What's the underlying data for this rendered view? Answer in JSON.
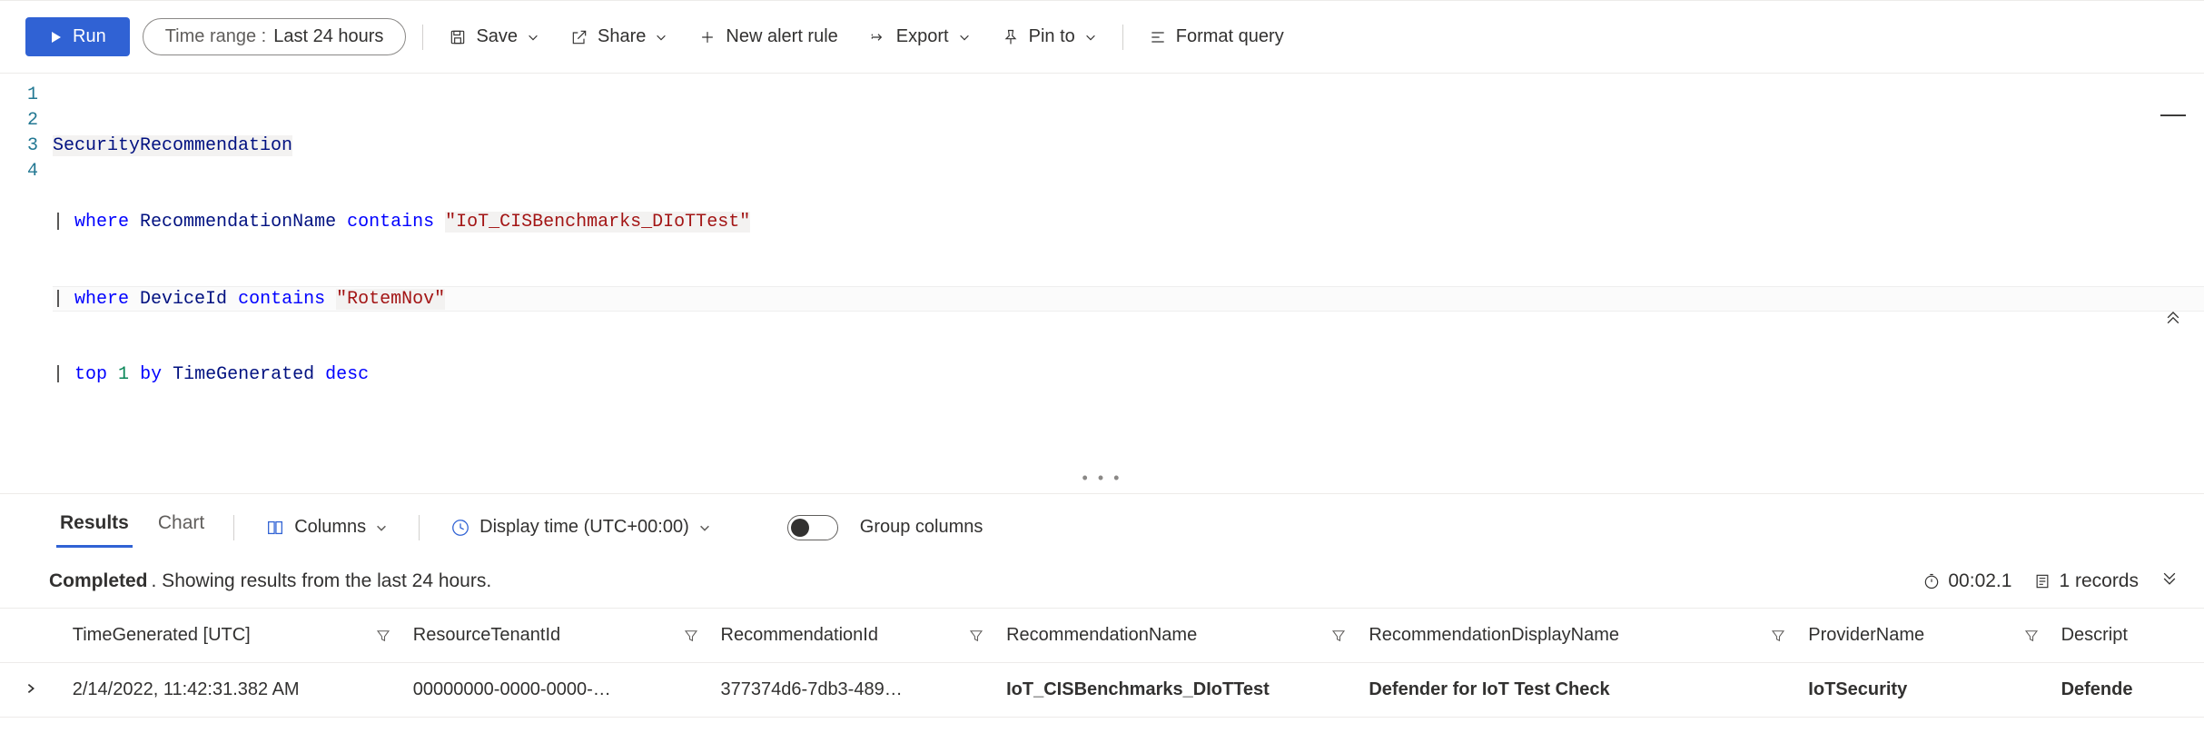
{
  "toolbar": {
    "run_label": "Run",
    "timerange_prefix": "Time range :",
    "timerange_value": "Last 24 hours",
    "save_label": "Save",
    "share_label": "Share",
    "new_alert_label": "New alert rule",
    "export_label": "Export",
    "pin_label": "Pin to",
    "format_label": "Format query"
  },
  "editor": {
    "line1_table": "SecurityRecommendation",
    "line2_kw": "where",
    "line2_col": "RecommendationName",
    "line2_op": "contains",
    "line2_str": "\"IoT_CISBenchmarks_DIoTTest\"",
    "line3_kw": "where",
    "line3_col": "DeviceId",
    "line3_op": "contains",
    "line3_str": "\"RotemNov\"",
    "line4_kw1": "top",
    "line4_num": "1",
    "line4_kw2": "by",
    "line4_col": "TimeGenerated",
    "line4_kw3": "desc",
    "drag_dots": "• • •"
  },
  "results_tabs": {
    "results": "Results",
    "chart": "Chart",
    "columns": "Columns",
    "display_time": "Display time (UTC+00:00)",
    "group_columns": "Group columns"
  },
  "status": {
    "completed": "Completed",
    "period_text": ". Showing results from the last 24 hours.",
    "duration": "00:02.1",
    "records": "1 records"
  },
  "table": {
    "headers": {
      "time": "TimeGenerated [UTC]",
      "tenant": "ResourceTenantId",
      "recid": "RecommendationId",
      "recname": "RecommendationName",
      "dispname": "RecommendationDisplayName",
      "provider": "ProviderName",
      "desc": "Descript"
    },
    "rows": [
      {
        "time": "2/14/2022, 11:42:31.382 AM",
        "tenant": "00000000-0000-0000-…",
        "recid": "377374d6-7db3-489…",
        "recname": "IoT_CISBenchmarks_DIoTTest",
        "dispname": "Defender for IoT Test Check",
        "provider": "IoTSecurity",
        "desc": "Defende"
      }
    ]
  }
}
